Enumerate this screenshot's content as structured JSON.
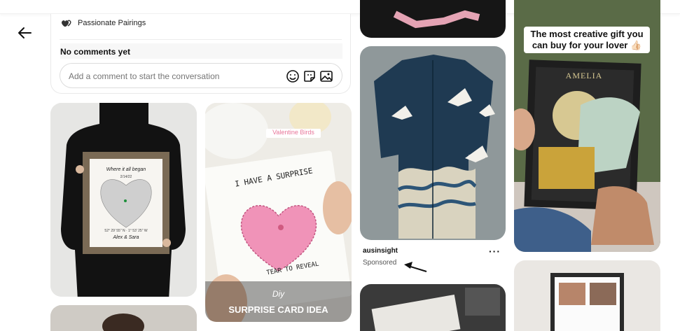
{
  "board": {
    "name": "Passionate Pairings",
    "icon": "heart-pair-icon"
  },
  "comments": {
    "empty_label": "No comments yet",
    "input_placeholder": "Add a comment to start the conversation",
    "actions": [
      "emoji-icon",
      "sticker-icon",
      "image-icon"
    ]
  },
  "pins": {
    "map_frame": {
      "heading": "Where it all began",
      "date": "2/14/22",
      "coords": "52° 29' 55\" N · 1° 53' 25\" W",
      "names": "Alex & Sara"
    },
    "card": {
      "tag": "Valentine Birds",
      "line1": "I HAVE A SURPRISE",
      "line2": "TEAR TO REVEAL",
      "bottom1": "Diy",
      "bottom2": "SURPRISE CARD IDEA"
    },
    "shirt": {
      "owner": "ausinsight",
      "sponsored": "Sponsored",
      "more": "···"
    },
    "moon": {
      "caption": "The most creative gift you can buy for your lover 👍🏻",
      "name": "AMELIA"
    }
  },
  "colors": {
    "accent_pink": "#e8769a",
    "text": "#111111"
  }
}
